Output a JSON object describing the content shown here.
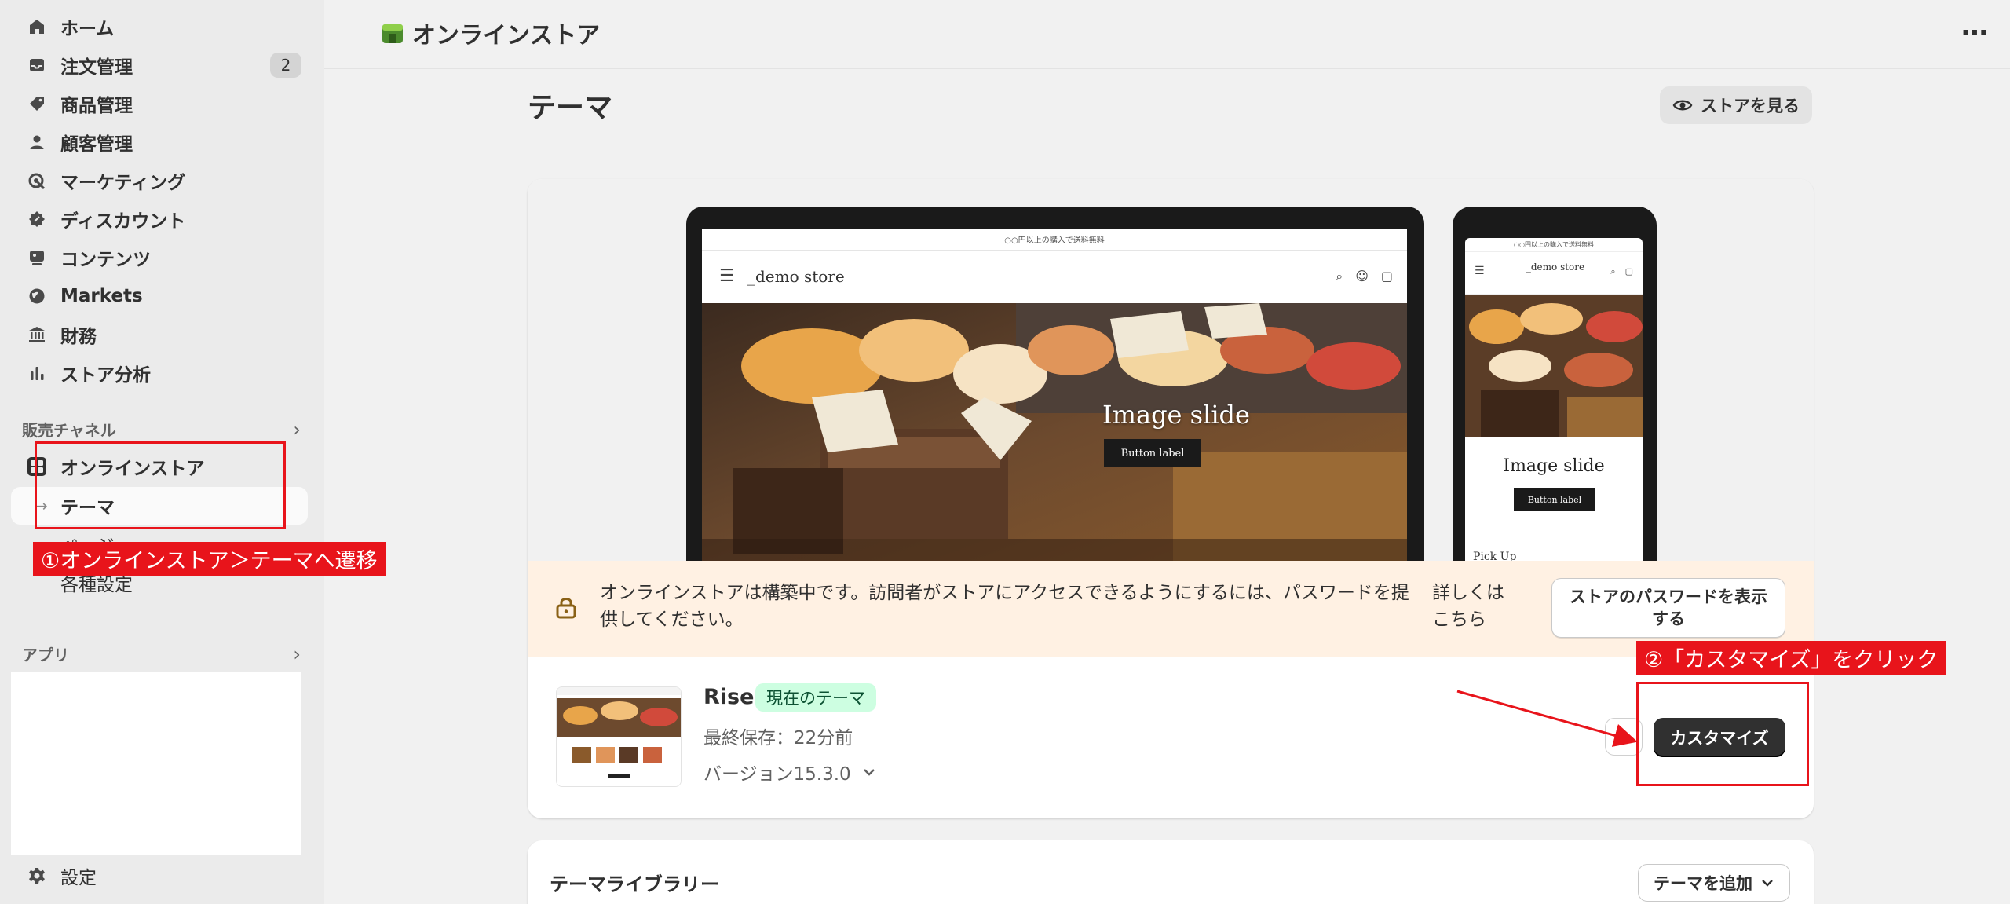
{
  "sidebar": {
    "items": [
      {
        "label": "ホーム",
        "icon": "home-icon"
      },
      {
        "label": "注文管理",
        "icon": "inbox-icon",
        "badge": "2"
      },
      {
        "label": "商品管理",
        "icon": "tag-icon"
      },
      {
        "label": "顧客管理",
        "icon": "person-icon"
      },
      {
        "label": "マーケティング",
        "icon": "target-icon"
      },
      {
        "label": "ディスカウント",
        "icon": "discount-icon"
      },
      {
        "label": "コンテンツ",
        "icon": "content-icon"
      },
      {
        "label": "Markets",
        "icon": "globe-icon"
      },
      {
        "label": "財務",
        "icon": "bank-icon"
      },
      {
        "label": "ストア分析",
        "icon": "chart-icon"
      }
    ],
    "sales_channels_label": "販売チャネル",
    "online_store_label": "オンラインストア",
    "sub_items": [
      "テーマ",
      "ページ",
      "各種設定"
    ],
    "apps_label": "アプリ",
    "settings_label": "設定"
  },
  "topbar": {
    "title": "オンラインストア"
  },
  "main": {
    "page_title": "テーマ",
    "view_store_label": "ストアを見る",
    "preview": {
      "announcement": "○○円以上の購入で送料無料",
      "store_name": "_demo store",
      "slide_title": "Image slide",
      "slide_button": "Button label",
      "mobile_section": "Pick Up"
    },
    "warning": {
      "message": "オンラインストアは構築中です。訪問者がストアにアクセスできるようにするには、パスワードを提供してください。",
      "learn_more": "詳しくはこちら",
      "password_button": "ストアのパスワードを表示する"
    },
    "current_theme": {
      "name": "Rise",
      "badge": "現在のテーマ",
      "saved": "最終保存：22分前",
      "version": "バージョン15.3.0",
      "customize_label": "カスタマイズ"
    },
    "library": {
      "title": "テーマライブラリー",
      "add_label": "テーマを追加"
    }
  },
  "annotations": {
    "step1": "①オンラインストア＞テーマへ遷移",
    "step2": "②「カスタマイズ」をクリック",
    "color": "#e8141b"
  }
}
